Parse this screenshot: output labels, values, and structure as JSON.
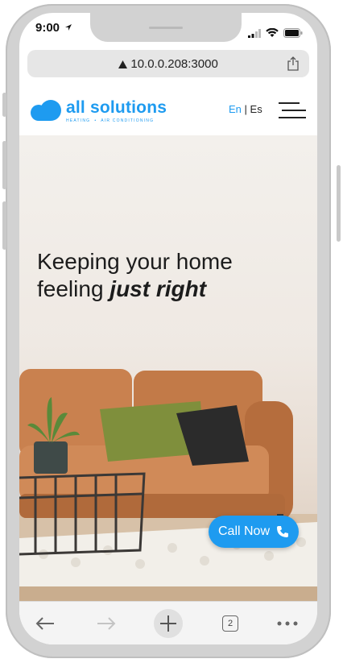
{
  "status_bar": {
    "time": "9:00"
  },
  "browser": {
    "url": "10.0.0.208:3000",
    "tab_count": "2"
  },
  "header": {
    "brand_name": "all solutions",
    "brand_tagline": "HEATING  •  AIR CONDITIONING",
    "lang_en": "En",
    "lang_sep": "|",
    "lang_es": "Es"
  },
  "hero": {
    "line1": "Keeping your home",
    "line2_prefix": "feeling ",
    "line2_emphasis": "just right"
  },
  "cta": {
    "call_label": "Call Now"
  },
  "colors": {
    "accent": "#1e9bf0",
    "text": "#1c1c1c"
  }
}
